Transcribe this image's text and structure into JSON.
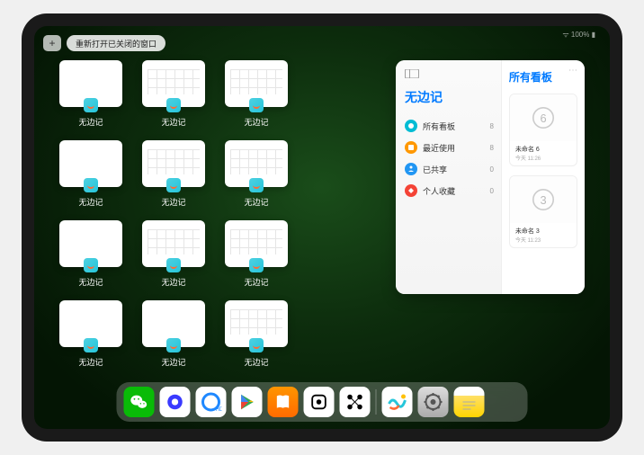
{
  "status": {
    "left": "",
    "right": "ᯤ 100% ▮"
  },
  "top": {
    "add": "+",
    "reopen": "重新打开已关闭的窗口"
  },
  "appName": "无边记",
  "thumbnails": {
    "rows": [
      [
        {
          "label": "无边记",
          "style": "blank"
        },
        {
          "label": "无边记",
          "style": "grid"
        },
        {
          "label": "无边记",
          "style": "grid"
        }
      ],
      [
        {
          "label": "无边记",
          "style": "blank"
        },
        {
          "label": "无边记",
          "style": "grid"
        },
        {
          "label": "无边记",
          "style": "grid"
        }
      ],
      [
        {
          "label": "无边记",
          "style": "blank"
        },
        {
          "label": "无边记",
          "style": "grid"
        },
        {
          "label": "无边记",
          "style": "grid"
        }
      ],
      [
        {
          "label": "无边记",
          "style": "blank"
        },
        {
          "label": "无边记",
          "style": "blank"
        },
        {
          "label": "无边记",
          "style": "grid"
        }
      ]
    ]
  },
  "panel": {
    "menu": "⋯",
    "left": {
      "title": "无边记",
      "items": [
        {
          "label": "所有看板",
          "count": "8",
          "color": "#00bcd4"
        },
        {
          "label": "最近使用",
          "count": "8",
          "color": "#ff9800"
        },
        {
          "label": "已共享",
          "count": "0",
          "color": "#2196f3"
        },
        {
          "label": "个人收藏",
          "count": "0",
          "color": "#f44336"
        }
      ]
    },
    "right": {
      "title": "所有看板",
      "boards": [
        {
          "name": "未命名 6",
          "time": "今天 11:26",
          "glyph": "6"
        },
        {
          "name": "未命名 3",
          "time": "今天 11:23",
          "glyph": "3"
        }
      ]
    }
  },
  "dock": [
    {
      "name": "wechat-icon"
    },
    {
      "name": "quark-icon"
    },
    {
      "name": "qqbrowser-icon"
    },
    {
      "name": "playstore-icon"
    },
    {
      "name": "books-icon"
    },
    {
      "name": "dice-icon"
    },
    {
      "name": "nodes-icon"
    },
    {
      "name": "separator"
    },
    {
      "name": "freeform-icon"
    },
    {
      "name": "settings-icon"
    },
    {
      "name": "notes-icon"
    },
    {
      "name": "applibrary-icon"
    }
  ]
}
